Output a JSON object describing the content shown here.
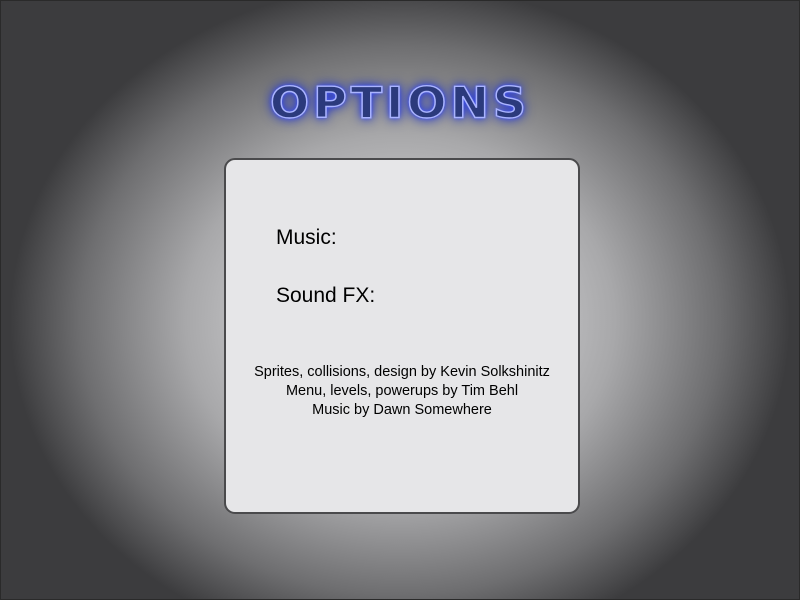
{
  "screen": {
    "title": "OPTIONS"
  },
  "options": {
    "music_label": "Music:",
    "sound_fx_label": "Sound FX:"
  },
  "credits": [
    "Sprites, collisions, design by Kevin Solkshinitz",
    "Menu, levels, powerups by Tim Behl",
    "Music by Dawn Somewhere"
  ],
  "colors": {
    "background": "#3c3c3e",
    "spotlight": "#ececee",
    "panel": "#e6e6e8",
    "title_fill": "#2b3a7c",
    "title_glow": "#4a5cff"
  }
}
